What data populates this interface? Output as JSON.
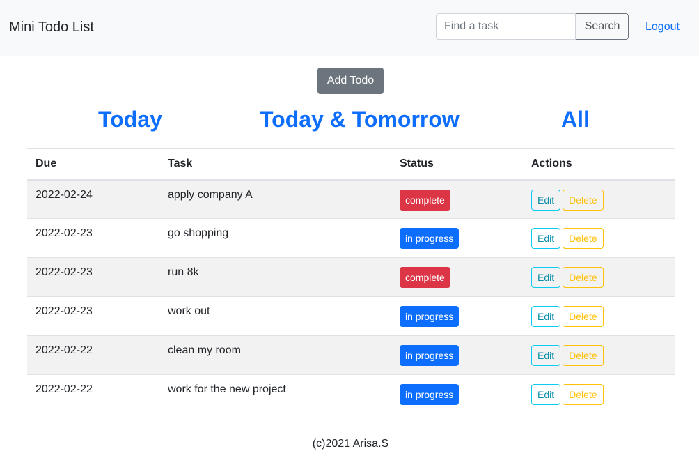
{
  "navbar": {
    "brand": "Mini Todo List",
    "search_placeholder": "Find a task",
    "search_value": "",
    "search_label": "Search",
    "logout_label": "Logout"
  },
  "actions": {
    "add_todo_label": "Add Todo"
  },
  "filters": {
    "today": "Today",
    "today_tomorrow": "Today & Tomorrow",
    "all": "All"
  },
  "table": {
    "headers": {
      "due": "Due",
      "task": "Task",
      "status": "Status",
      "actions": "Actions"
    },
    "edit_label": "Edit",
    "delete_label": "Delete",
    "rows": [
      {
        "due": "2022-02-24",
        "task": "apply company A",
        "status": "complete"
      },
      {
        "due": "2022-02-23",
        "task": "go shopping",
        "status": "in progress"
      },
      {
        "due": "2022-02-23",
        "task": "run 8k",
        "status": "complete"
      },
      {
        "due": "2022-02-23",
        "task": "work out",
        "status": "in progress"
      },
      {
        "due": "2022-02-22",
        "task": "clean my room",
        "status": "in progress"
      },
      {
        "due": "2022-02-22",
        "task": "work for the new project",
        "status": "in progress"
      }
    ]
  },
  "footer": {
    "copyright": "(c)2021 Arisa.S"
  },
  "colors": {
    "link": "#0d6efd",
    "complete": "#dc3545",
    "in_progress": "#0d6efd",
    "edit": "#0dcaf0",
    "delete": "#ffc107",
    "secondary": "#6c757d"
  }
}
